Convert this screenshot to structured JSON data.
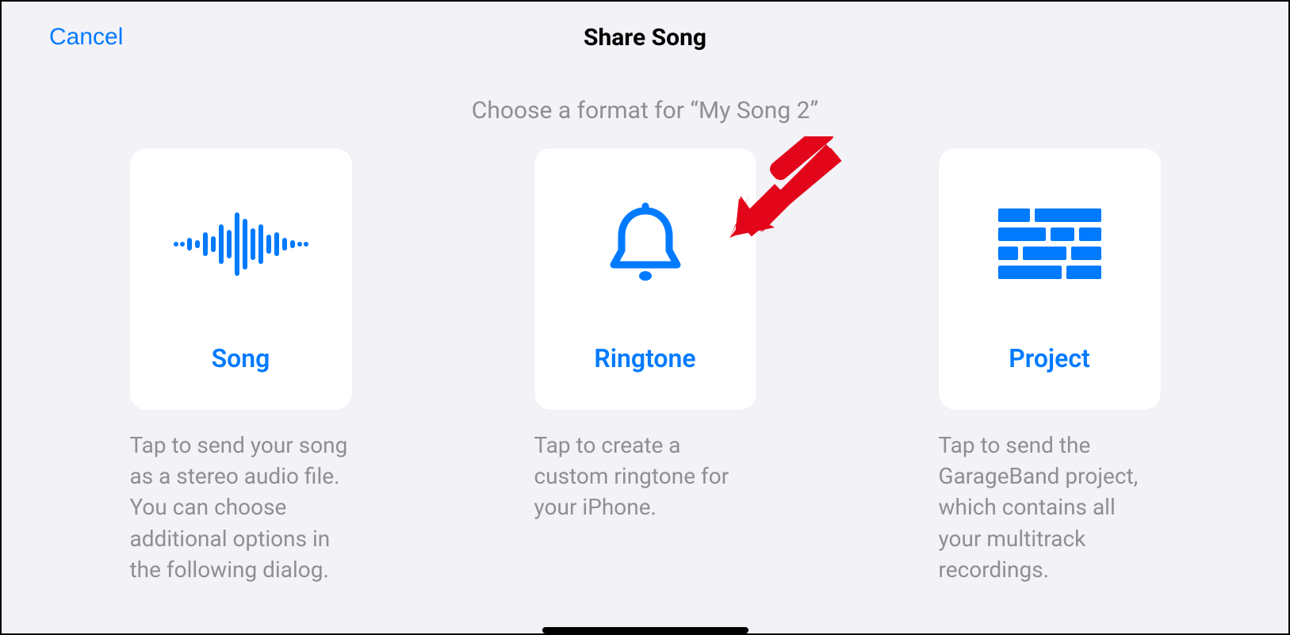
{
  "header": {
    "cancel_label": "Cancel",
    "title": "Share Song"
  },
  "subtitle": "Choose a format for “My Song 2”",
  "cards": [
    {
      "label": "Song",
      "description": "Tap to send your song as a stereo audio file. You can choose additional options in the following dialog."
    },
    {
      "label": "Ringtone",
      "description": "Tap to create a custom ringtone for your iPhone."
    },
    {
      "label": "Project",
      "description": "Tap to send the GarageBand project, which contains all your multitrack recordings."
    }
  ]
}
